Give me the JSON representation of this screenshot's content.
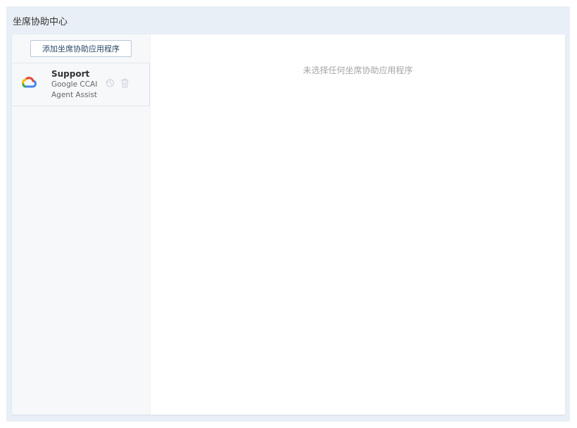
{
  "header": {
    "title": "坐席协助中心"
  },
  "sidebar": {
    "add_button_label": "添加坐席协助应用程序",
    "items": [
      {
        "name": "Support",
        "provider": "Google CCAI",
        "type": "Agent Assist",
        "logo": "google-cloud-icon",
        "actions": [
          "history-icon",
          "trash-icon"
        ]
      }
    ]
  },
  "main": {
    "empty_message": "未选择任何坐席协助应用程序"
  },
  "colors": {
    "frame_background": "#e9eff6",
    "sidebar_background": "#f6f8fa",
    "button_border": "#b9c9d8",
    "muted_text": "#a6a6a6",
    "logo_blue": "#4285F4",
    "logo_red": "#EA4335",
    "logo_yellow": "#FBBC05",
    "logo_green": "#34A853"
  }
}
